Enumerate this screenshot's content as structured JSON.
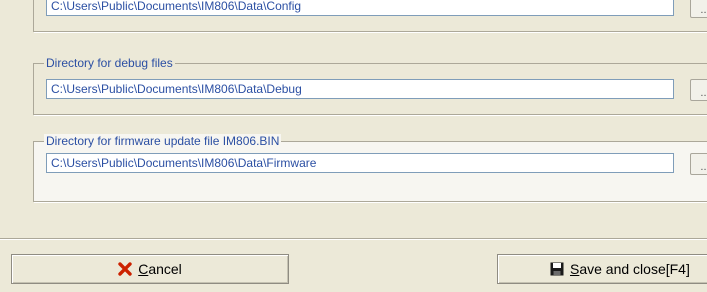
{
  "config": {
    "path": "C:\\Users\\Public\\Documents\\IM806\\Data\\Config"
  },
  "debug": {
    "legend": "Directory for debug files",
    "path": "C:\\Users\\Public\\Documents\\IM806\\Data\\Debug"
  },
  "firmware": {
    "legend": "Directory for firmware update file IM806.BIN",
    "path": "C:\\Users\\Public\\Documents\\IM806\\Data\\Firmware"
  },
  "browse_label": "...",
  "buttons": {
    "cancel": {
      "accel": "C",
      "rest": "ancel"
    },
    "save": {
      "accel": "S",
      "rest": "ave and close[F4]"
    }
  },
  "colors": {
    "label": "#2b4fa3",
    "cancel_icon": "#cc2200"
  },
  "icons": {
    "cancel": "x-icon",
    "save": "floppy-disk-icon"
  }
}
